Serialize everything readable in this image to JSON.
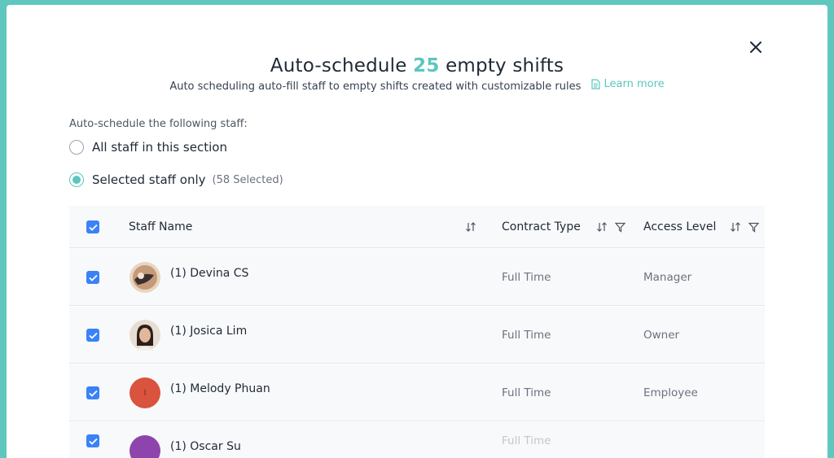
{
  "dialog": {
    "title_prefix": "Auto-schedule",
    "title_count": "25",
    "title_suffix": "empty shifts",
    "subtitle": "Auto scheduling auto-fill staff to empty shifts created with customizable rules",
    "learn_more": "Learn more",
    "close_icon": "close-icon"
  },
  "staff_scope": {
    "label": "Auto-schedule the following staff:",
    "options": [
      {
        "label": "All staff in this section",
        "selected": false
      },
      {
        "label": "Selected staff only",
        "selected": true,
        "note": "(58 Selected)"
      }
    ]
  },
  "table": {
    "select_all_checked": true,
    "columns": [
      {
        "label": "Staff Name",
        "icons": [
          "sort-icon"
        ]
      },
      {
        "label": "Contract Type",
        "icons": [
          "sort-icon",
          "filter-icon"
        ]
      },
      {
        "label": "Access Level",
        "icons": [
          "sort-icon",
          "filter-icon"
        ]
      }
    ],
    "rows": [
      {
        "checked": true,
        "name": "(1) Devina CS",
        "contract": "Full Time",
        "access": "Manager",
        "avatar": "photo",
        "avatar_color": "#c9a27e"
      },
      {
        "checked": true,
        "name": "(1) Josica Lim",
        "contract": "Full Time",
        "access": "Owner",
        "avatar": "photo",
        "avatar_color": "#d8c7b8"
      },
      {
        "checked": true,
        "name": "(1) Melody Phuan",
        "contract": "Full Time",
        "access": "Employee",
        "avatar": "initial",
        "avatar_color": "#d9533f",
        "avatar_initial": "I"
      },
      {
        "checked": true,
        "name": "(1) Oscar Su",
        "contract": "Full Time",
        "access": "",
        "avatar": "initial",
        "avatar_color": "#8e44ad"
      }
    ]
  },
  "colors": {
    "accent": "#5cc6bd",
    "checkbox": "#3b82f6",
    "backdrop": "#5fc7be"
  }
}
